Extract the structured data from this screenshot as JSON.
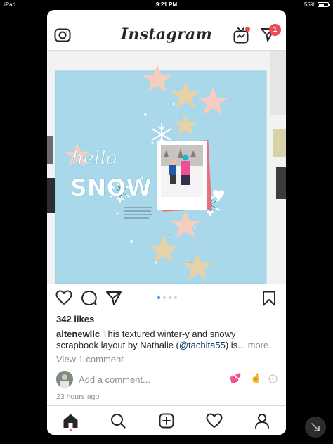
{
  "status_bar": {
    "device": "iPad",
    "time": "9:21 PM",
    "battery": "55%",
    "battery_level": 0.55
  },
  "header": {
    "logo": "Instagram",
    "dm_badge": "1"
  },
  "post": {
    "image_title_word1": "hello",
    "image_title_word2": "SNOW",
    "carousel_count": 4,
    "carousel_active_index": 0,
    "likes": "342 likes",
    "caption": {
      "username": "altenewllc",
      "text_before": " This textured winter-y and snowy scrapbook layout by Nathalie (",
      "mention": "@tachita55",
      "text_after": ") is... ",
      "more": "more"
    },
    "view_comments": "View 1 comment",
    "add_comment_placeholder": "Add a comment...",
    "quick_emojis": [
      "💕",
      "🤞"
    ],
    "timestamp": "23 hours ago"
  },
  "tabbar": {
    "tabs": [
      "home",
      "search",
      "new-post",
      "activity",
      "profile"
    ],
    "active": "home"
  },
  "colors": {
    "accent_blue": "#3897f0",
    "notification_red": "#ed4956",
    "paper_blue": "#a9d8ea",
    "text": "#262626",
    "secondary_text": "#8e8e8e"
  }
}
